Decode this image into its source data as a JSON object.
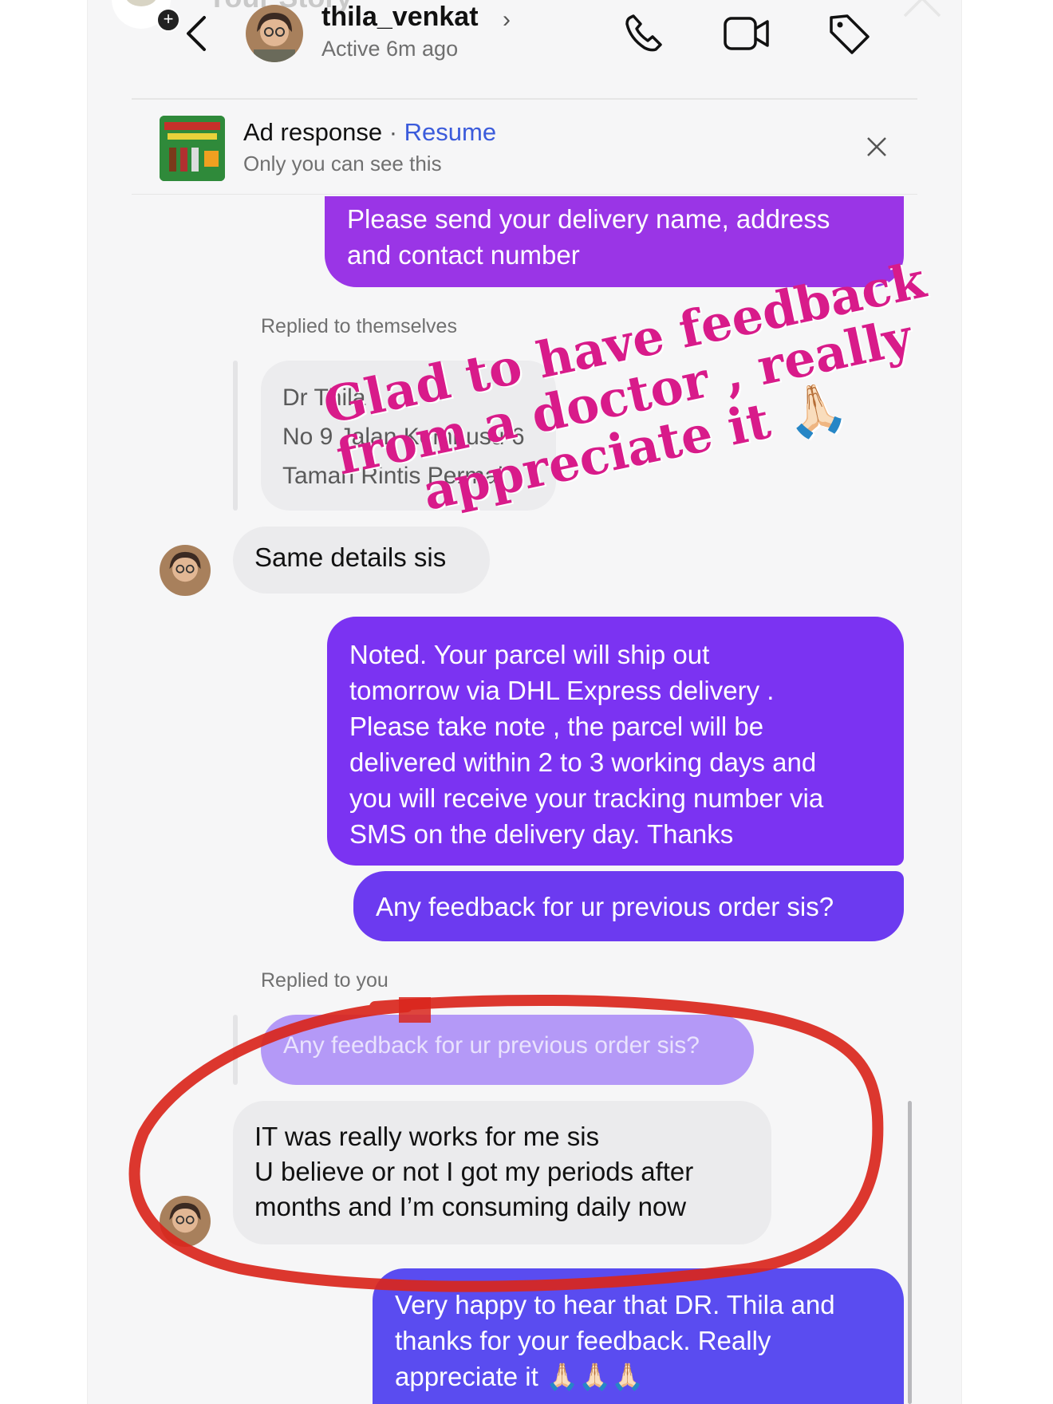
{
  "story": {
    "label": "Your Story",
    "add_symbol": "+"
  },
  "header": {
    "username": "thila_venkat",
    "status": "Active 6m ago",
    "icons": [
      "back-icon",
      "phone-icon",
      "video-icon",
      "tag-icon",
      "close-icon"
    ]
  },
  "ad_banner": {
    "title": "Ad response",
    "separator": "·",
    "action": "Resume",
    "subtitle": "Only you can see this"
  },
  "messages": {
    "out1": [
      "Please send your delivery name, address",
      "and contact number"
    ],
    "reply1_label": "Replied to themselves",
    "quote1": [
      "Dr Thila",
      "No 9 Jalan Kembusu 6",
      "Taman Rintis Permai"
    ],
    "in1": "Same details  sis",
    "out2": [
      "Noted. Your parcel will ship out",
      "tomorrow via DHL Express delivery .",
      "Please take note , the parcel will be",
      "delivered within 2 to 3 working days and",
      "you will receive your tracking number via",
      "SMS on the delivery day. Thanks"
    ],
    "out3": "Any feedback for ur previous order sis?",
    "reply2_label": "Replied to you",
    "quote2": "Any feedback for ur previous order sis?",
    "in2": [
      "IT was really works for me sis",
      "U believe or not I got my periods after",
      "months and I’m consuming daily now"
    ],
    "out4": [
      "Very happy to hear that DR. Thila and",
      "thanks for your feedback. Really",
      "appreciate it 🙏🏻🙏🏻🙏🏻"
    ]
  },
  "overlay": {
    "lines": [
      "Glad to have feedback",
      "from a doctor , really",
      "appreciate it 🙏🏻"
    ],
    "color": "#d81b8a"
  },
  "colors": {
    "bubble_purple_1": "#9a35e6",
    "bubble_purple_2": "#7b33f2",
    "bubble_blue": "#5a4cf0",
    "resume_link": "#3b5bdb",
    "annotation_ring": "#d9261c"
  }
}
